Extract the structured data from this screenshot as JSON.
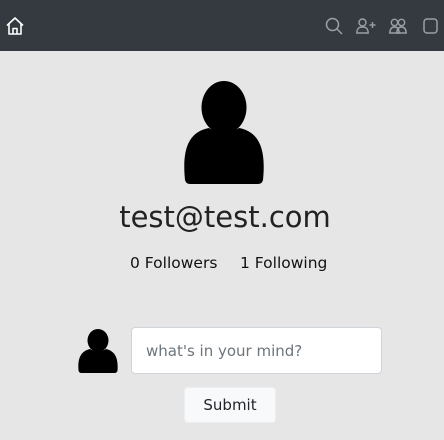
{
  "navbar": {
    "icons": [
      "home-icon",
      "search-icon",
      "add-user-icon",
      "users-icon",
      "square-icon"
    ]
  },
  "profile": {
    "email": "test@test.com",
    "followers_label": "0 Followers",
    "following_label": "1 Following"
  },
  "post": {
    "placeholder": "what's in your mind?",
    "submit_label": "Submit"
  },
  "colors": {
    "navbar_bg": "#343a40",
    "page_bg": "#e6e6e6",
    "icon_color": "#9aa0a6",
    "home_icon_color": "#ffffff"
  }
}
